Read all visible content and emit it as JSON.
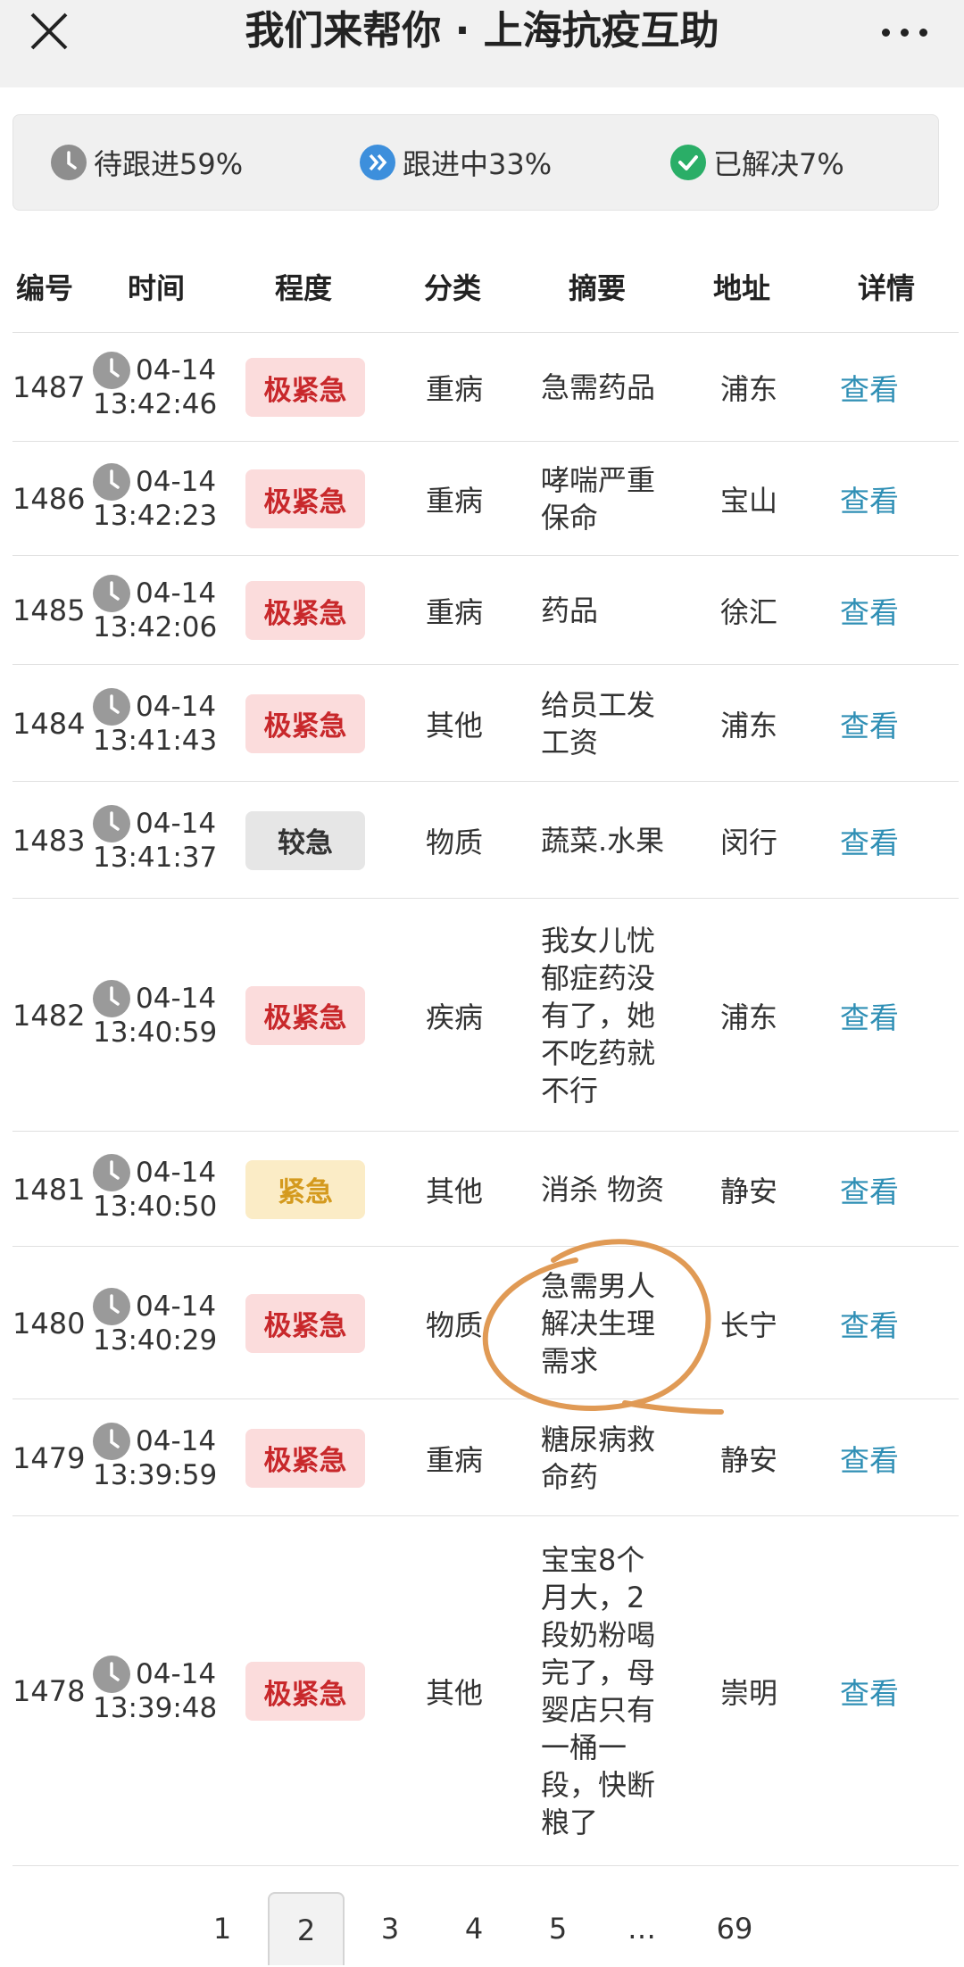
{
  "nav": {
    "title": "我们来帮你 · 上海抗疫互助"
  },
  "status": [
    {
      "label": "待跟进59%",
      "color": "#8e8e8e",
      "icon": "clock-icon"
    },
    {
      "label": "跟进中33%",
      "color": "#3d8fdc",
      "icon": "double-chevron-icon"
    },
    {
      "label": "已解决7%",
      "color": "#2aae67",
      "icon": "check-icon"
    }
  ],
  "table": {
    "headers": [
      "编号",
      "时间",
      "程度",
      "分类",
      "摘要",
      "地址",
      "详情"
    ],
    "rows": [
      {
        "id": "1487",
        "date": "04-14",
        "time": "13:42:46",
        "level": "极紧急",
        "levelType": "critical",
        "category": "重病",
        "summary": "急需药品",
        "address": "浦东",
        "detail": "查看"
      },
      {
        "id": "1486",
        "date": "04-14",
        "time": "13:42:23",
        "level": "极紧急",
        "levelType": "critical",
        "category": "重病",
        "summary": "哮喘严重保命",
        "address": "宝山",
        "detail": "查看"
      },
      {
        "id": "1485",
        "date": "04-14",
        "time": "13:42:06",
        "level": "极紧急",
        "levelType": "critical",
        "category": "重病",
        "summary": "药品",
        "address": "徐汇",
        "detail": "查看"
      },
      {
        "id": "1484",
        "date": "04-14",
        "time": "13:41:43",
        "level": "极紧急",
        "levelType": "critical",
        "category": "其他",
        "summary": "给员工发工资",
        "address": "浦东",
        "detail": "查看"
      },
      {
        "id": "1483",
        "date": "04-14",
        "time": "13:41:37",
        "level": "较急",
        "levelType": "moderate",
        "category": "物质",
        "summary": "蔬菜.水果",
        "address": "闵行",
        "detail": "查看"
      },
      {
        "id": "1482",
        "date": "04-14",
        "time": "13:40:59",
        "level": "极紧急",
        "levelType": "critical",
        "category": "疾病",
        "summary": "我女儿忧郁症药没有了，她不吃药就不行",
        "address": "浦东",
        "detail": "查看"
      },
      {
        "id": "1481",
        "date": "04-14",
        "time": "13:40:50",
        "level": "紧急",
        "levelType": "urgent",
        "category": "其他",
        "summary": "消杀 物资",
        "address": "静安",
        "detail": "查看"
      },
      {
        "id": "1480",
        "date": "04-14",
        "time": "13:40:29",
        "level": "极紧急",
        "levelType": "critical",
        "category": "物质",
        "summary": "急需男人解决生理需求",
        "address": "长宁",
        "detail": "查看"
      },
      {
        "id": "1479",
        "date": "04-14",
        "time": "13:39:59",
        "level": "极紧急",
        "levelType": "critical",
        "category": "重病",
        "summary": "糖尿病救命药",
        "address": "静安",
        "detail": "查看"
      },
      {
        "id": "1478",
        "date": "04-14",
        "time": "13:39:48",
        "level": "极紧急",
        "levelType": "critical",
        "category": "其他",
        "summary": "宝宝8个月大，2段奶粉喝完了，母婴店只有一桶一段，快断粮了",
        "address": "崇明",
        "detail": "查看"
      }
    ]
  },
  "levelStyles": {
    "critical": {
      "bg": "#fbdcdc",
      "fg": "#c8282b"
    },
    "moderate": {
      "bg": "#e6e6e6",
      "fg": "#333333"
    },
    "urgent": {
      "bg": "#fbecc6",
      "fg": "#d49a1e"
    }
  },
  "pager": {
    "pages": [
      "1",
      "2",
      "3",
      "4",
      "5",
      "…",
      "69"
    ],
    "current": "2"
  },
  "annotation": {
    "color": "#e09a55"
  }
}
